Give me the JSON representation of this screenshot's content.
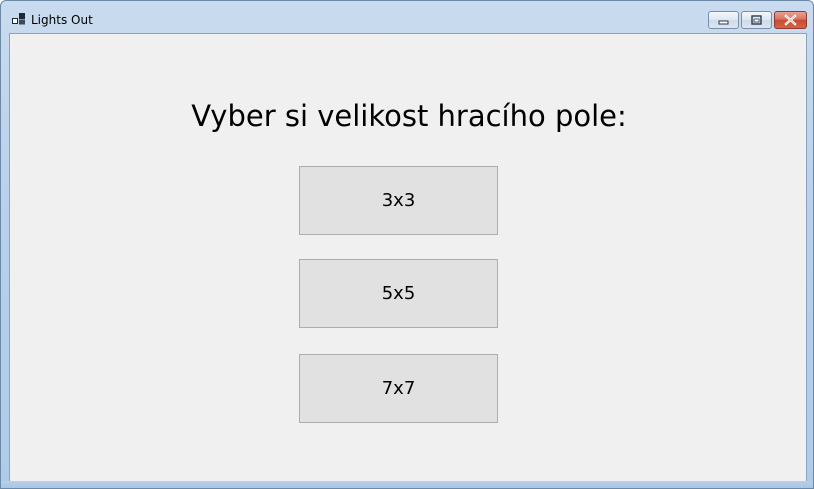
{
  "window": {
    "title": "Lights Out",
    "icon": "app-grid-icon"
  },
  "caption_buttons": {
    "minimize": "minimize-icon",
    "maximize": "maximize-icon",
    "close": "close-icon"
  },
  "main": {
    "heading": "Vyber si velikost hracího pole:",
    "buttons": [
      {
        "label": "3x3"
      },
      {
        "label": "5x5"
      },
      {
        "label": "7x7"
      }
    ]
  }
}
